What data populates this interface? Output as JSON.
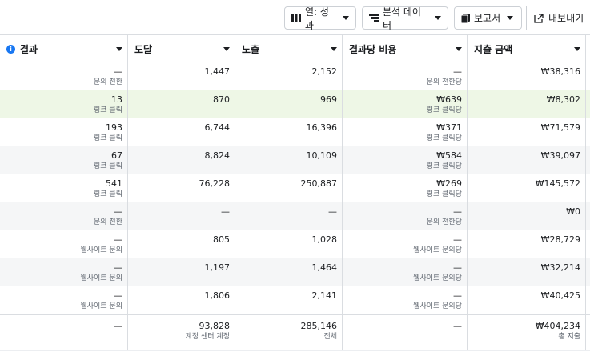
{
  "toolbar": {
    "columns_label": "열: 성과",
    "breakdown_label": "분석 데이터",
    "reports_label": "보고서",
    "export_label": "내보내기"
  },
  "table": {
    "headers": [
      "결과",
      "도달",
      "노출",
      "결과당 비용",
      "지출 금액"
    ],
    "rows": [
      {
        "result": "—",
        "result_sub": "문의 전환",
        "reach": "1,447",
        "impressions": "2,152",
        "cpr": "—",
        "cpr_sub": "문의 전환당",
        "spend": "₩38,316"
      },
      {
        "result": "13",
        "result_sub": "링크 클릭",
        "reach": "870",
        "impressions": "969",
        "cpr": "₩639",
        "cpr_sub": "링크 클릭당",
        "spend": "₩8,302"
      },
      {
        "result": "193",
        "result_sub": "링크 클릭",
        "reach": "6,744",
        "impressions": "16,396",
        "cpr": "₩371",
        "cpr_sub": "링크 클릭당",
        "spend": "₩71,579"
      },
      {
        "result": "67",
        "result_sub": "링크 클릭",
        "reach": "8,824",
        "impressions": "10,109",
        "cpr": "₩584",
        "cpr_sub": "링크 클릭당",
        "spend": "₩39,097"
      },
      {
        "result": "541",
        "result_sub": "링크 클릭",
        "reach": "76,228",
        "impressions": "250,887",
        "cpr": "₩269",
        "cpr_sub": "링크 클릭당",
        "spend": "₩145,572"
      },
      {
        "result": "—",
        "result_sub": "문의 전환",
        "reach": "—",
        "impressions": "—",
        "cpr": "—",
        "cpr_sub": "문의 전환당",
        "spend": "₩0"
      },
      {
        "result": "—",
        "result_sub": "웹사이트 문의",
        "reach": "805",
        "impressions": "1,028",
        "cpr": "—",
        "cpr_sub": "웹사이트 문의당",
        "spend": "₩28,729"
      },
      {
        "result": "—",
        "result_sub": "웹사이트 문의",
        "reach": "1,197",
        "impressions": "1,464",
        "cpr": "—",
        "cpr_sub": "웹사이트 문의당",
        "spend": "₩32,214"
      },
      {
        "result": "—",
        "result_sub": "웹사이트 문의",
        "reach": "1,806",
        "impressions": "2,141",
        "cpr": "—",
        "cpr_sub": "웹사이트 문의당",
        "spend": "₩40,425"
      }
    ],
    "summary": {
      "result": "—",
      "reach": "93,828",
      "reach_sub": "계정 센터 계정",
      "impressions": "285,146",
      "impressions_sub": "전체",
      "cpr": "—",
      "spend": "₩404,234",
      "spend_sub": "총 지출"
    }
  }
}
